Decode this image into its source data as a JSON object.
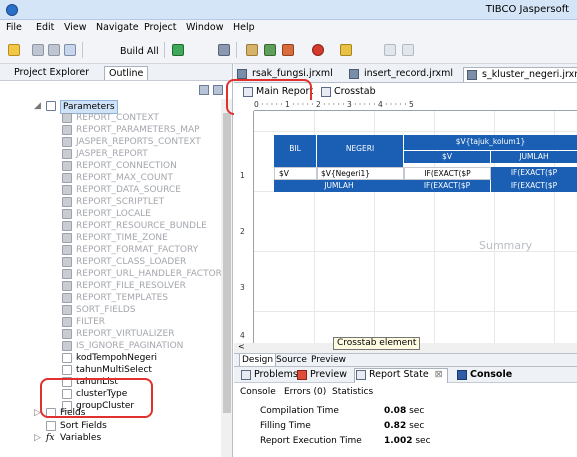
{
  "window": {
    "title": "TIBCO Jaspersoft"
  },
  "menu": [
    "File",
    "Edit",
    "View",
    "Navigate",
    "Project",
    "Window",
    "Help"
  ],
  "toolbar": {
    "build_all": "Build All"
  },
  "left_panel": {
    "tabs": [
      "Project Explorer",
      "Outline"
    ],
    "tree": {
      "root_label": "Parameters",
      "items": [
        "REPORT_CONTEXT",
        "REPORT_PARAMETERS_MAP",
        "JASPER_REPORTS_CONTEXT",
        "JASPER_REPORT",
        "REPORT_CONNECTION",
        "REPORT_MAX_COUNT",
        "REPORT_DATA_SOURCE",
        "REPORT_SCRIPTLET",
        "REPORT_LOCALE",
        "REPORT_RESOURCE_BUNDLE",
        "REPORT_TIME_ZONE",
        "REPORT_FORMAT_FACTORY",
        "REPORT_CLASS_LOADER",
        "REPORT_URL_HANDLER_FACTORY",
        "REPORT_FILE_RESOLVER",
        "REPORT_TEMPLATES",
        "SORT_FIELDS",
        "FILTER",
        "REPORT_VIRTUALIZER",
        "IS_IGNORE_PAGINATION"
      ],
      "user_items": [
        "kodTempohNegeri",
        "tahunMultiSelect",
        "tahunList",
        "clusterType",
        "groupCluster"
      ],
      "sections": [
        "Fields",
        "Sort Fields",
        "Variables"
      ]
    }
  },
  "editor": {
    "tabs": [
      "rsak_fungsi.jrxml",
      "insert_record.jrxml",
      "s_kluster_negeri.jrxml"
    ],
    "subtabs": [
      "Main Report",
      "Crosstab"
    ],
    "ruler_text": "0 · · · · · 1 · · · · · 2 · · · · · 3 · · · · · 4 · · · · · 5",
    "crosstab": {
      "col_header": "$V{tajuk_kolum1}",
      "header_bil": "BIL",
      "header_negeri": "NEGERI",
      "sub_v": "$V",
      "sub_jumlah": "JUMLAH",
      "row_bil": "$V",
      "row_negeri": "$V{Negeri1}",
      "row_val1": "IF(EXACT($P",
      "row_val2": "IF(EXACT($P",
      "total_label": "JUMLAH",
      "total_val1": "IF(EXACT($P",
      "total_val2": "IF(EXACT($P"
    },
    "summary_label": "Summary",
    "tooltip": "Crosstab element",
    "design_tabs": [
      "Design",
      "Source",
      "Preview"
    ]
  },
  "bottom_panel": {
    "tabs": [
      "Problems",
      "Preview",
      "Report State",
      "Console"
    ],
    "subtabs": [
      "Console",
      "Errors (0)",
      "Statistics"
    ],
    "stats": [
      {
        "label": "Compilation Time",
        "value": "0.08",
        "unit": "sec"
      },
      {
        "label": "Filling Time",
        "value": "0.82",
        "unit": "sec"
      },
      {
        "label": "Report Execution Time",
        "value": "1.002",
        "unit": "sec"
      }
    ]
  }
}
